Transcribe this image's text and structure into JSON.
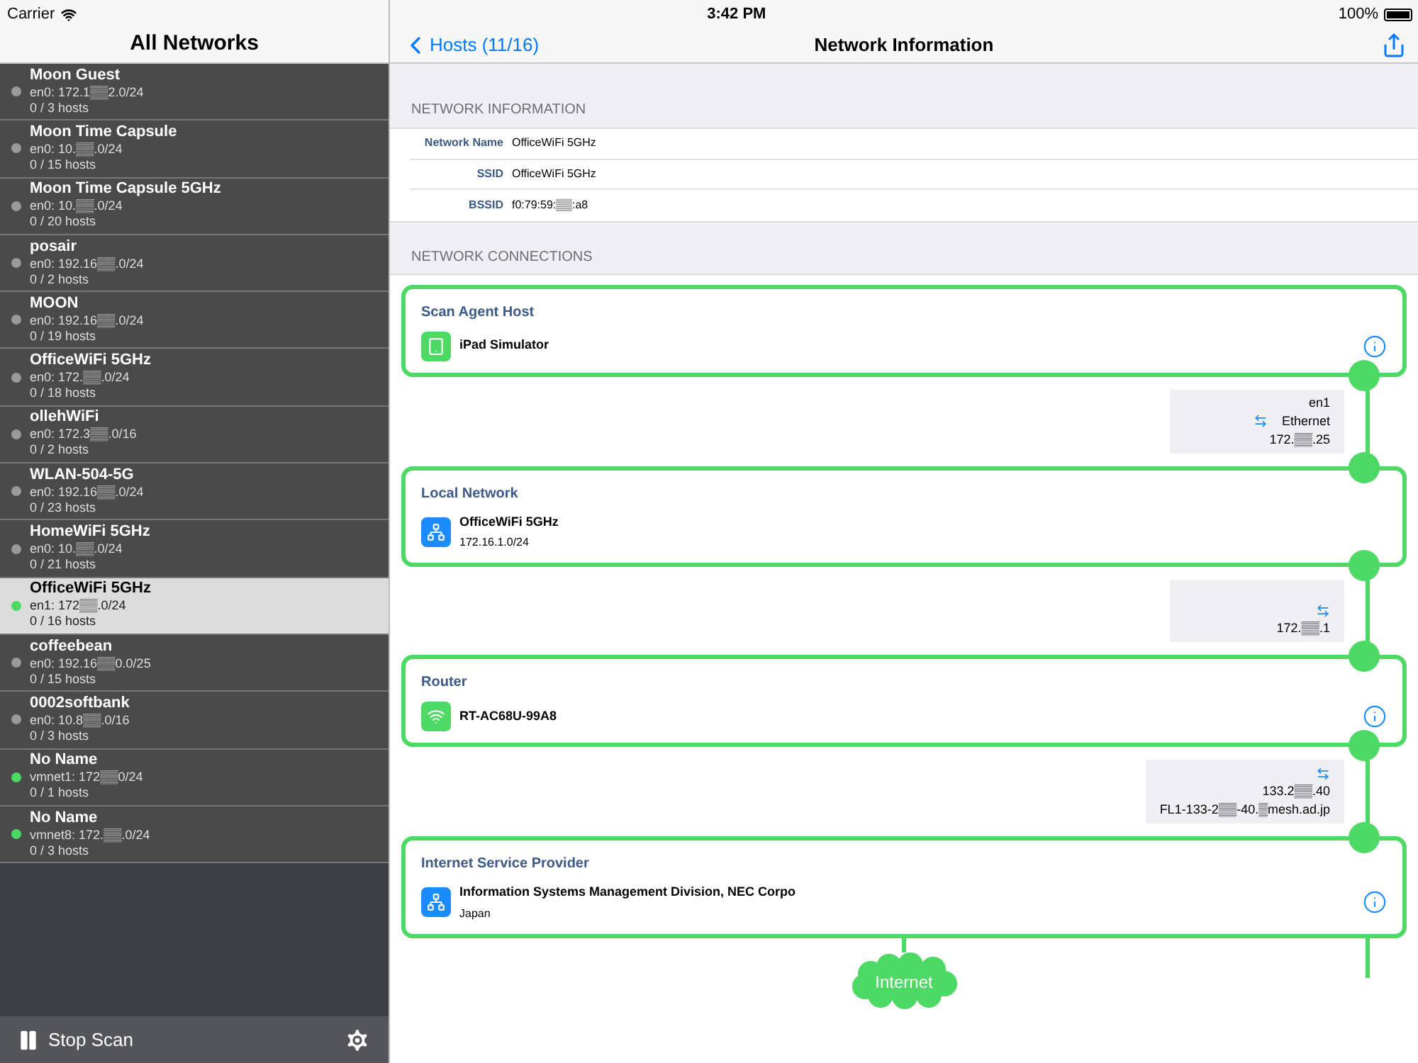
{
  "status_bar": {
    "carrier": "Carrier",
    "time": "3:42 PM",
    "battery": "100%"
  },
  "sidebar": {
    "title": "All Networks",
    "items": [
      {
        "name": "Moon Guest",
        "subnet": "en0: 172.1▒▒2.0/24",
        "hosts": "0 / 3 hosts",
        "active": false,
        "selected": false
      },
      {
        "name": "Moon Time Capsule",
        "subnet": "en0: 10.▒▒.0/24",
        "hosts": "0 / 15 hosts",
        "active": false,
        "selected": false
      },
      {
        "name": "Moon Time Capsule 5GHz",
        "subnet": "en0: 10.▒▒.0/24",
        "hosts": "0 / 20 hosts",
        "active": false,
        "selected": false
      },
      {
        "name": "posair",
        "subnet": "en0: 192.16▒▒.0/24",
        "hosts": "0 / 2 hosts",
        "active": false,
        "selected": false
      },
      {
        "name": "MOON",
        "subnet": "en0: 192.16▒▒.0/24",
        "hosts": "0 / 19 hosts",
        "active": false,
        "selected": false
      },
      {
        "name": "OfficeWiFi 5GHz",
        "subnet": "en0: 172.▒▒.0/24",
        "hosts": "0 / 18 hosts",
        "active": false,
        "selected": false
      },
      {
        "name": "ollehWiFi",
        "subnet": "en0: 172.3▒▒.0/16",
        "hosts": "0 / 2 hosts",
        "active": false,
        "selected": false
      },
      {
        "name": "WLAN-504-5G",
        "subnet": "en0: 192.16▒▒.0/24",
        "hosts": "0 / 23 hosts",
        "active": false,
        "selected": false
      },
      {
        "name": "HomeWiFi 5GHz",
        "subnet": "en0: 10.▒▒.0/24",
        "hosts": "0 / 21 hosts",
        "active": false,
        "selected": false
      },
      {
        "name": "OfficeWiFi 5GHz",
        "subnet": "en1: 172▒▒.0/24",
        "hosts": "0 / 16 hosts",
        "active": true,
        "selected": true
      },
      {
        "name": "coffeebean",
        "subnet": "en0: 192.16▒▒0.0/25",
        "hosts": "0 / 15 hosts",
        "active": false,
        "selected": false
      },
      {
        "name": "0002softbank",
        "subnet": "en0: 10.8▒▒.0/16",
        "hosts": "0 / 3 hosts",
        "active": false,
        "selected": false
      },
      {
        "name": "No Name",
        "subnet": "vmnet1: 172▒▒0/24",
        "hosts": "0 / 1 hosts",
        "active": true,
        "selected": false
      },
      {
        "name": "No Name",
        "subnet": "vmnet8: 172.▒▒.0/24",
        "hosts": "0 / 3 hosts",
        "active": true,
        "selected": false
      }
    ],
    "toolbar": {
      "scan_button": "Stop Scan"
    }
  },
  "nav": {
    "back": "Hosts (11/16)",
    "title": "Network Information"
  },
  "info_section": {
    "header": "NETWORK INFORMATION",
    "rows": [
      {
        "label": "Network Name",
        "value": "OfficeWiFi 5GHz"
      },
      {
        "label": "SSID",
        "value": "OfficeWiFi 5GHz"
      },
      {
        "label": "BSSID",
        "value": "f0:79:59:▒▒:a8"
      }
    ]
  },
  "connections": {
    "header": "NETWORK CONNECTIONS",
    "nodes": [
      {
        "heading": "Scan Agent Host",
        "kind": "tablet",
        "name": "iPad Simulator",
        "info": true,
        "link": [
          {
            "icon": false,
            "text": "en1"
          },
          {
            "icon": true,
            "text": "Ethernet"
          },
          {
            "icon": false,
            "text": "172.▒▒.25"
          }
        ]
      },
      {
        "heading": "Local Network",
        "kind": "network",
        "name": "OfficeWiFi 5GHz",
        "detail": "172.16.1.0/24",
        "info": false,
        "link": [
          {
            "icon": true
          },
          {
            "icon": false,
            "text": "172.▒▒.1"
          }
        ]
      },
      {
        "heading": "Router",
        "kind": "wifi",
        "name": "RT-AC68U-99A8",
        "info": true,
        "link": [
          {
            "icon": true
          },
          {
            "icon": false,
            "text": "133.2▒▒.40"
          },
          {
            "icon": false,
            "text": "FL1-133-2▒▒-40.▒mesh.ad.jp"
          }
        ]
      },
      {
        "heading": "Internet Service Provider",
        "kind": "network",
        "name": "Information Systems Management Division, NEC Corpo",
        "detail": "Japan",
        "info": true
      }
    ],
    "end": "Internet"
  }
}
